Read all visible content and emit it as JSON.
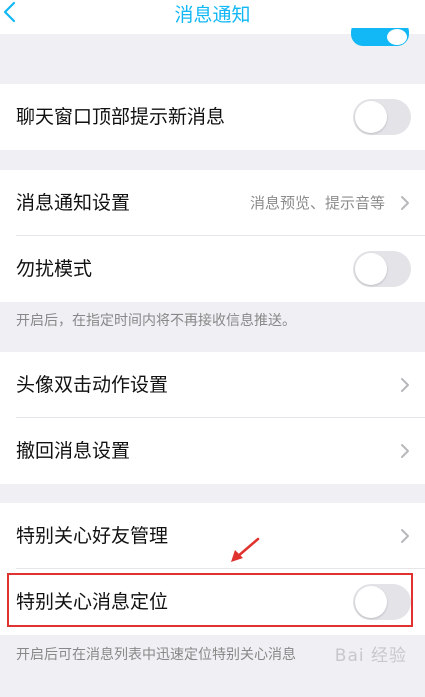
{
  "header": {
    "title": "消息通知"
  },
  "rows": {
    "chat_top_notify": {
      "label": "聊天窗口顶部提示新消息"
    },
    "notify_settings": {
      "label": "消息通知设置",
      "sub": "消息预览、提示音等"
    },
    "dnd": {
      "label": "勿扰模式"
    },
    "avatar_double_tap": {
      "label": "头像双击动作设置"
    },
    "recall": {
      "label": "撤回消息设置"
    },
    "special_friends": {
      "label": "特别关心好友管理"
    },
    "special_locate": {
      "label": "特别关心消息定位"
    }
  },
  "notes": {
    "dnd": "开启后，在指定时间内将不再接收信息推送。",
    "special_locate": "开启后可在消息列表中迅速定位特别关心消息"
  },
  "watermark": "Bai 经验",
  "colors": {
    "accent": "#12b7f5",
    "annotation": "#e0322e"
  }
}
